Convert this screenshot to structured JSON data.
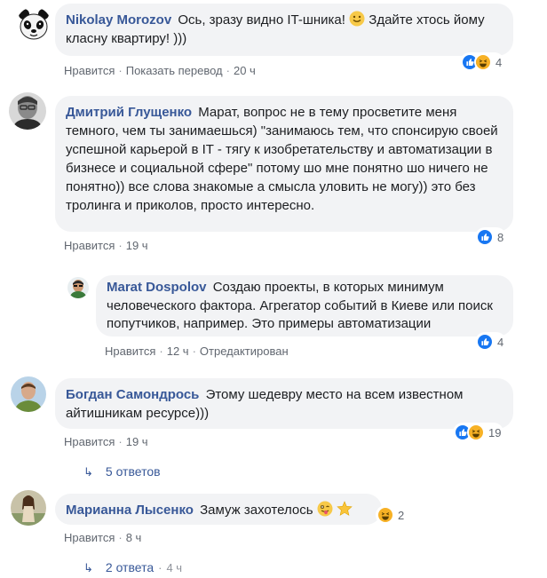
{
  "comments": [
    {
      "author": "Nikolay Morozov",
      "text_a": "Ось, зразу видно IT-шника!",
      "text_b": "Здайте хтось йому класну квартиру! )))",
      "actions": [
        "Нравится",
        "Показать перевод"
      ],
      "time": "20 ч",
      "reaction_count": "4"
    },
    {
      "author": "Дмитрий Глущенко",
      "text": "Марат, вопрос не в тему просветите меня темного, чем ты занимаешься) \"занимаюсь тем, что спонсирую своей успешной карьерой в IT - тягу к изобретательству и автоматизации в бизнесе и социальной сфере\" потому шо мне понятно шо ничего не понятно)) все слова знакомые а смысла уловить не могу)) это без тролинга и приколов, просто интересно.",
      "actions": [
        "Нравится"
      ],
      "time": "19 ч",
      "reaction_count": "8"
    },
    {
      "author": "Marat Dospolov",
      "text": "Создаю проекты, в которых минимум человеческого фактора. Агрегатор событий в Киеве или поиск попутчиков, например. Это примеры автоматизации",
      "actions": [
        "Нравится"
      ],
      "time": "12 ч",
      "edited": "Отредактирован",
      "reaction_count": "4"
    },
    {
      "author": "Богдан Самондрось",
      "text": "Этому шедевру место на всем известном айтишникам ресурсе)))",
      "actions": [
        "Нравится"
      ],
      "time": "19 ч",
      "reaction_count": "19",
      "replies": "5 ответов"
    },
    {
      "author": "Марианна Лысенко",
      "text": "Замуж захотелось",
      "actions": [
        "Нравится"
      ],
      "time": "8 ч",
      "reaction_count": "2",
      "replies": "2 ответа",
      "replies_time": "4 ч"
    }
  ],
  "separator": "·",
  "icons": {
    "like": "like-icon",
    "haha": "haha-icon",
    "reply_arrow": "reply-arrow-icon"
  },
  "colors": {
    "link": "#385898",
    "bubble": "#f2f3f5",
    "meta": "#616770",
    "like": "#1877f2",
    "haha": "#f7b125"
  }
}
